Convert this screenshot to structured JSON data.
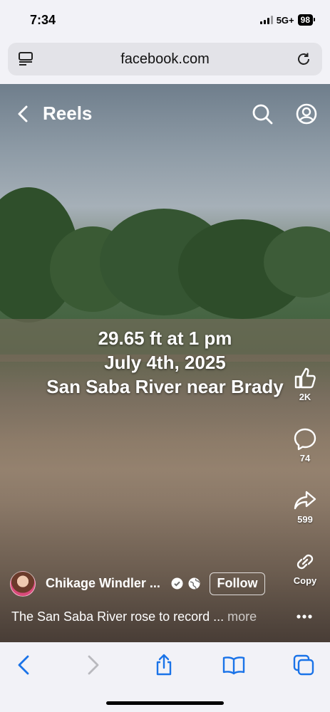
{
  "status_bar": {
    "time": "7:34",
    "network": "5G+",
    "battery": "98"
  },
  "browser": {
    "url": "facebook.com"
  },
  "reels": {
    "title": "Reels",
    "overlay_lines": [
      "29.65 ft at 1 pm",
      "July 4th, 2025",
      "San Saba River near Brady"
    ],
    "likes": "2K",
    "comments": "74",
    "shares": "599",
    "copy_label": "Copy",
    "author_name": "Chikage Windler ...",
    "follow_label": "Follow",
    "caption": "The San Saba River rose to record ...",
    "caption_more": "more"
  },
  "icons": {
    "back": "chevron-left-icon",
    "search": "search-icon",
    "profile": "profile-icon",
    "like": "thumbs-up-icon",
    "comment": "comment-icon",
    "share": "share-icon",
    "copy": "link-icon"
  },
  "colors": {
    "accent": "#1a73e8",
    "inactive": "#b9b9be"
  }
}
